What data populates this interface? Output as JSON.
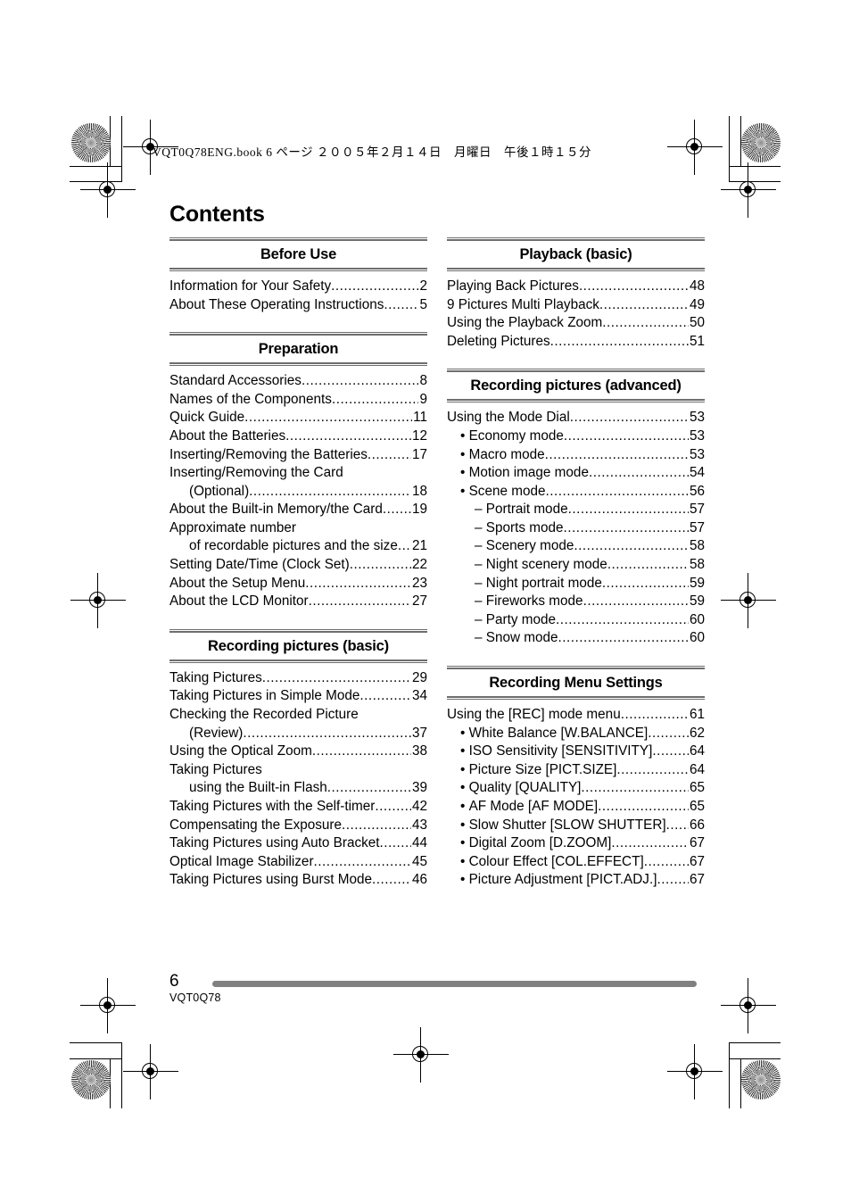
{
  "document": {
    "book_header": "VQT0Q78ENG.book   6 ページ   ２００５年２月１４日　月曜日　午後１時１５分",
    "title": "Contents",
    "page_number": "6",
    "product_code": "VQT0Q78",
    "bar_color": "#808080",
    "rule_color": "#6e6e6e"
  },
  "left_column": [
    {
      "section": "Before Use",
      "entries": [
        {
          "level": 1,
          "label": "Information for Your Safety",
          "page": "2"
        },
        {
          "level": 1,
          "label": "About These Operating Instructions",
          "page": "5"
        }
      ]
    },
    {
      "section": "Preparation",
      "entries": [
        {
          "level": 1,
          "label": "Standard Accessories",
          "page": "8"
        },
        {
          "level": 1,
          "label": "Names of the Components",
          "page": "9"
        },
        {
          "level": 1,
          "label": "Quick Guide",
          "page": "11"
        },
        {
          "level": 1,
          "label": "About the Batteries",
          "page": "12"
        },
        {
          "level": 1,
          "label": "Inserting/Removing the Batteries",
          "page": "17"
        },
        {
          "level": 1,
          "label": "Inserting/Removing the Card",
          "page": "",
          "leader": false
        },
        {
          "level": "cont",
          "label": "(Optional)",
          "page": "18"
        },
        {
          "level": 1,
          "label": "About the Built-in Memory/the Card",
          "page": "19"
        },
        {
          "level": 1,
          "label": "Approximate number",
          "page": "",
          "leader": false
        },
        {
          "level": "cont",
          "label": "of recordable pictures and the size",
          "page": "21"
        },
        {
          "level": 1,
          "label": "Setting Date/Time (Clock Set)",
          "page": "22"
        },
        {
          "level": 1,
          "label": "About the Setup Menu",
          "page": "23"
        },
        {
          "level": 1,
          "label": "About the LCD Monitor",
          "page": "27"
        }
      ]
    },
    {
      "section": "Recording pictures (basic)",
      "entries": [
        {
          "level": 1,
          "label": "Taking Pictures",
          "page": "29"
        },
        {
          "level": 1,
          "label": "Taking Pictures in Simple Mode",
          "page": "34"
        },
        {
          "level": 1,
          "label": "Checking the Recorded Picture",
          "page": "",
          "leader": false
        },
        {
          "level": "cont",
          "label": "(Review)",
          "page": "37"
        },
        {
          "level": 1,
          "label": "Using the Optical Zoom",
          "page": "38"
        },
        {
          "level": 1,
          "label": "Taking Pictures",
          "page": "",
          "leader": false
        },
        {
          "level": "cont",
          "label": "using the Built-in Flash",
          "page": "39"
        },
        {
          "level": 1,
          "label": "Taking Pictures with the Self-timer",
          "page": "42"
        },
        {
          "level": 1,
          "label": "Compensating the Exposure",
          "page": "43"
        },
        {
          "level": 1,
          "label": "Taking Pictures using Auto Bracket",
          "page": "44"
        },
        {
          "level": 1,
          "label": "Optical Image Stabilizer",
          "page": "45"
        },
        {
          "level": 1,
          "label": "Taking Pictures using Burst Mode",
          "page": "46"
        }
      ]
    }
  ],
  "right_column": [
    {
      "section": "Playback (basic)",
      "entries": [
        {
          "level": 1,
          "label": "Playing Back Pictures",
          "page": "48"
        },
        {
          "level": 1,
          "label": "9 Pictures Multi Playback",
          "page": "49"
        },
        {
          "level": 1,
          "label": "Using the Playback Zoom",
          "page": "50"
        },
        {
          "level": 1,
          "label": "Deleting Pictures",
          "page": "51"
        }
      ]
    },
    {
      "section": "Recording pictures (advanced)",
      "entries": [
        {
          "level": 1,
          "label": "Using the Mode Dial",
          "page": "53"
        },
        {
          "level": 2,
          "label": "Economy mode",
          "page": "53"
        },
        {
          "level": 2,
          "label": "Macro mode",
          "page": "53"
        },
        {
          "level": 2,
          "label": "Motion image mode",
          "page": "54"
        },
        {
          "level": 2,
          "label": "Scene mode",
          "page": "56"
        },
        {
          "level": 3,
          "label": "Portrait mode",
          "page": "57"
        },
        {
          "level": 3,
          "label": "Sports mode",
          "page": "57"
        },
        {
          "level": 3,
          "label": "Scenery mode",
          "page": "58"
        },
        {
          "level": 3,
          "label": "Night scenery mode",
          "page": "58"
        },
        {
          "level": 3,
          "label": "Night portrait mode",
          "page": "59"
        },
        {
          "level": 3,
          "label": "Fireworks mode",
          "page": "59"
        },
        {
          "level": 3,
          "label": "Party mode",
          "page": "60"
        },
        {
          "level": 3,
          "label": "Snow mode",
          "page": "60"
        }
      ]
    },
    {
      "section": "Recording Menu Settings",
      "entries": [
        {
          "level": 1,
          "label": "Using the [REC] mode menu",
          "page": "61"
        },
        {
          "level": 2,
          "label": "White Balance [W.BALANCE]",
          "page": "62"
        },
        {
          "level": 2,
          "label": "ISO Sensitivity [SENSITIVITY]",
          "page": "64"
        },
        {
          "level": 2,
          "label": "Picture Size [PICT.SIZE]",
          "page": "64"
        },
        {
          "level": 2,
          "label": "Quality [QUALITY]",
          "page": "65"
        },
        {
          "level": 2,
          "label": "AF Mode [AF MODE]",
          "page": "65"
        },
        {
          "level": 2,
          "label": "Slow Shutter [SLOW SHUTTER]",
          "page": "66"
        },
        {
          "level": 2,
          "label": "Digital Zoom [D.ZOOM]",
          "page": "67"
        },
        {
          "level": 2,
          "label": "Colour Effect [COL.EFFECT]",
          "page": "67"
        },
        {
          "level": 2,
          "label": "Picture Adjustment [PICT.ADJ.]",
          "page": "67"
        }
      ]
    }
  ]
}
